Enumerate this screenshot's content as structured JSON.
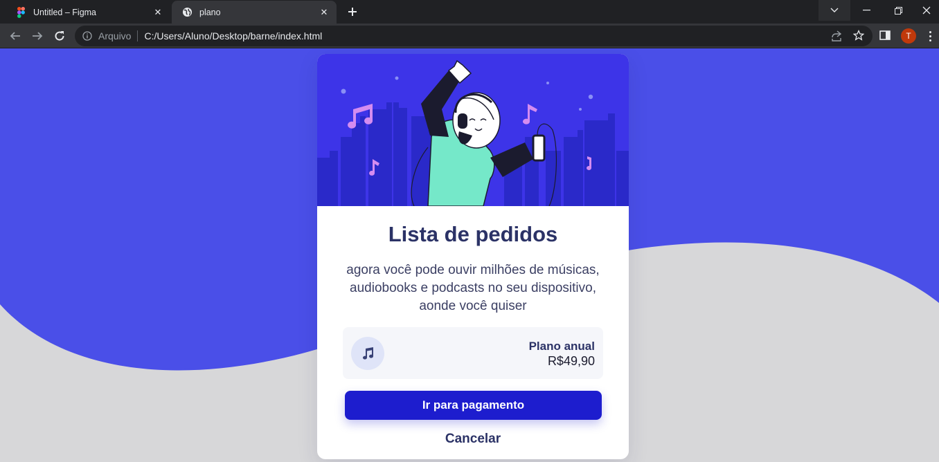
{
  "browser": {
    "tabs": [
      {
        "title": "Untitled – Figma",
        "icon": "figma-icon"
      },
      {
        "title": "plano",
        "icon": "globe-icon"
      }
    ],
    "address": {
      "scheme_label": "Arquivo",
      "url": "C:/Users/Aluno/Desktop/barne/index.html"
    },
    "profile_initial": "T"
  },
  "colors": {
    "background_top": "#4a4fe8",
    "background_bottom": "#d7d7d9",
    "hero_bg": "#3d34e8",
    "city_silhouette": "#2a29c9",
    "title_color": "#2b3266",
    "button_color": "#1d1dce",
    "music_note": "#d48cf0"
  },
  "card": {
    "title": "Lista de pedidos",
    "description": "agora você pode ouvir milhões de músicas, audiobooks e podcasts no seu dispositivo, aonde você quiser",
    "plan": {
      "icon": "music-note-icon",
      "name": "Plano anual",
      "price": "R$49,90"
    },
    "pay_button": "Ir para pagamento",
    "cancel_button": "Cancelar"
  }
}
